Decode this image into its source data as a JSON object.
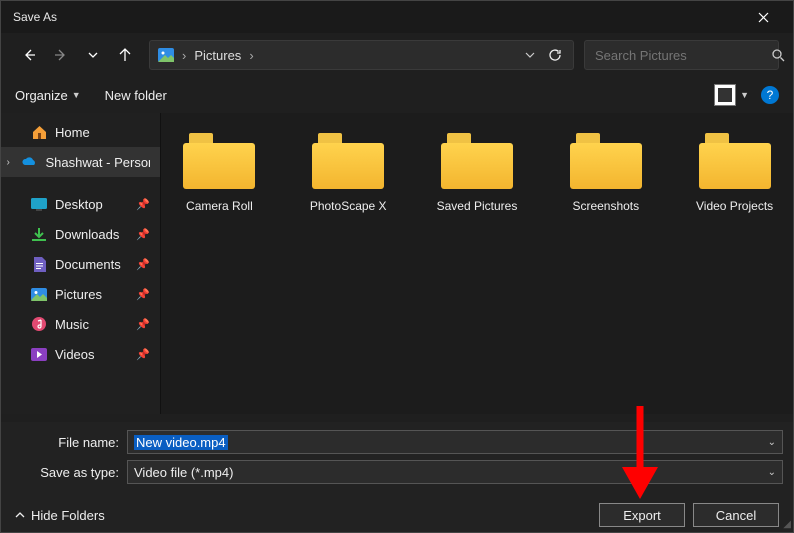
{
  "title": "Save As",
  "breadcrumb": {
    "location": "Pictures"
  },
  "search": {
    "placeholder": "Search Pictures"
  },
  "toolbar": {
    "organize": "Organize",
    "new_folder": "New folder"
  },
  "tree": {
    "home": "Home",
    "personal": "Shashwat - Personal",
    "quick": [
      {
        "label": "Desktop"
      },
      {
        "label": "Downloads"
      },
      {
        "label": "Documents"
      },
      {
        "label": "Pictures"
      },
      {
        "label": "Music"
      },
      {
        "label": "Videos"
      }
    ]
  },
  "folders": [
    "Camera Roll",
    "PhotoScape X",
    "Saved Pictures",
    "Screenshots",
    "Video Projects"
  ],
  "form": {
    "filename_label": "File name:",
    "filename_value": "New video.mp4",
    "type_label": "Save as type:",
    "type_value": "Video file (*.mp4)"
  },
  "footer": {
    "hide_folders": "Hide Folders",
    "export": "Export",
    "cancel": "Cancel"
  }
}
